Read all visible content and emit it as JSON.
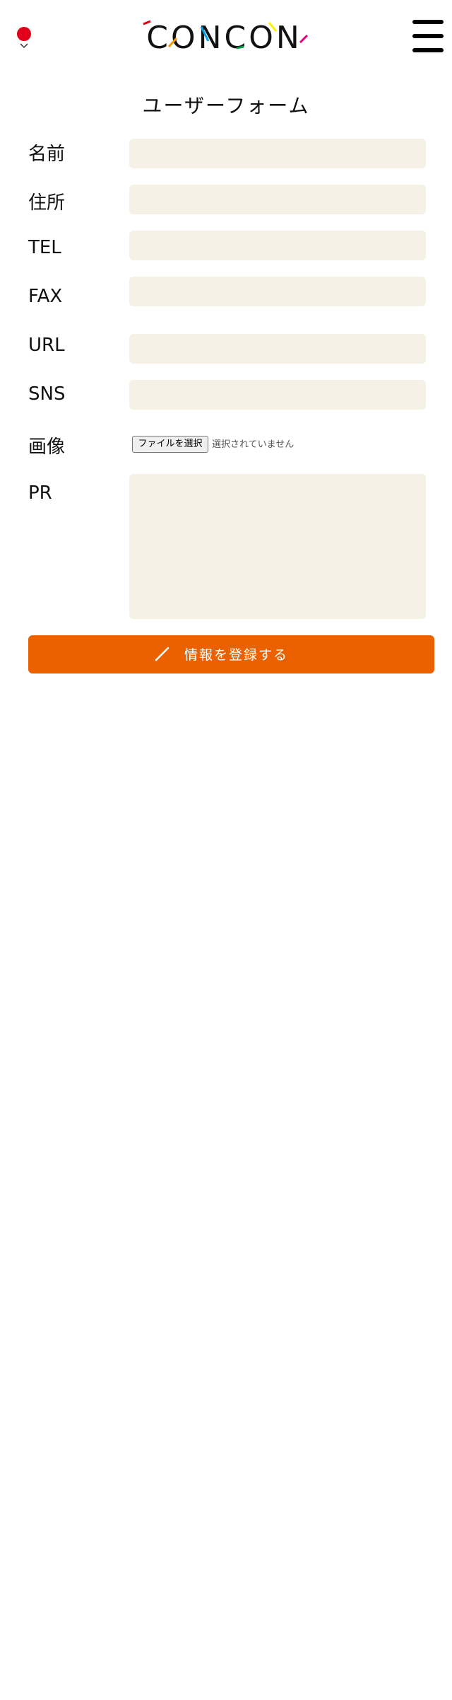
{
  "header": {
    "logo_text": "CONCON",
    "language_flag_color": "#e3001b",
    "menu_icon": "hamburger-menu-icon"
  },
  "page": {
    "title": "ユーザーフォーム"
  },
  "form": {
    "fields": [
      {
        "label": "名前",
        "value": ""
      },
      {
        "label": "住所",
        "value": ""
      },
      {
        "label": "TEL",
        "value": ""
      },
      {
        "label": "FAX",
        "value": ""
      },
      {
        "label": "URL",
        "value": ""
      },
      {
        "label": "SNS",
        "value": ""
      }
    ],
    "image": {
      "label": "画像",
      "button_label": "ファイルを選択",
      "status": "選択されていません"
    },
    "pr": {
      "label": "PR",
      "value": ""
    },
    "submit": {
      "label": "情報を登録する",
      "icon": "pencil-icon",
      "color": "#eb6100"
    },
    "input_background": "#f5f1e6"
  }
}
